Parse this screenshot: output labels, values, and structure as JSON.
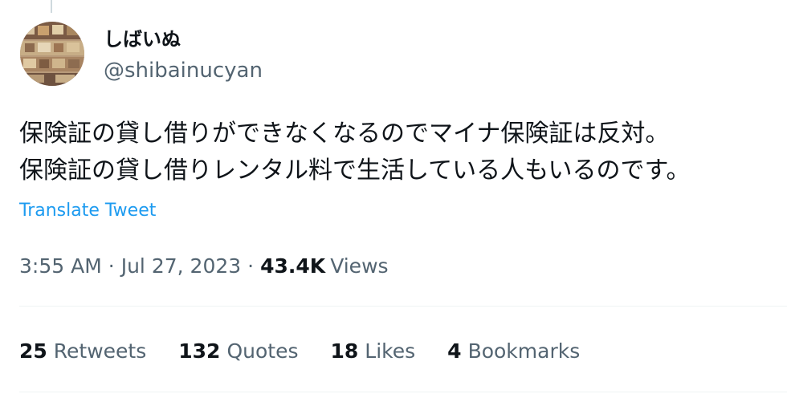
{
  "author": {
    "display_name": "しばいぬ",
    "handle": "@shibainucyan"
  },
  "tweet": {
    "lines": [
      "保険証の貸し借りができなくなるのでマイナ保険証は反対。",
      "保険証の貸し借りレンタル料で生活している人もいるのです。"
    ],
    "translate_label": "Translate Tweet"
  },
  "meta": {
    "time": "3:55 AM",
    "separator": "·",
    "date": "Jul 27, 2023",
    "views_count": "43.4K",
    "views_label": "Views"
  },
  "stats": {
    "retweets_count": "25",
    "retweets_label": "Retweets",
    "quotes_count": "132",
    "quotes_label": "Quotes",
    "likes_count": "18",
    "likes_label": "Likes",
    "bookmarks_count": "4",
    "bookmarks_label": "Bookmarks"
  },
  "colors": {
    "link": "#1d9bf0",
    "secondary_text": "#536471",
    "primary_text": "#0f1419",
    "divider": "#eff3f4"
  }
}
